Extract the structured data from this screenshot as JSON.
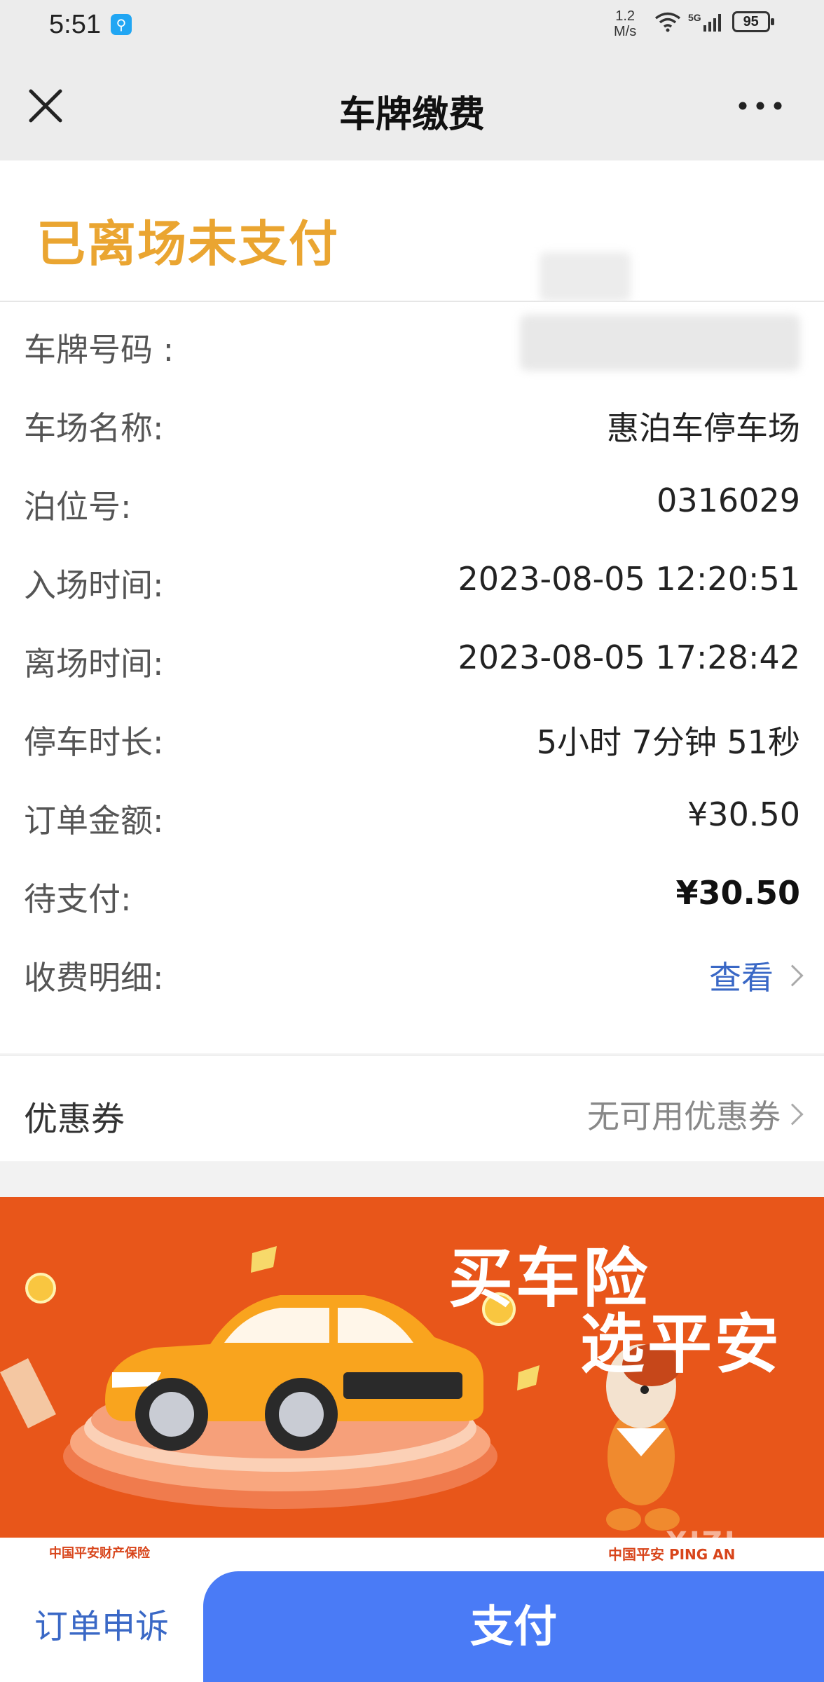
{
  "status_bar": {
    "time": "5:51",
    "speed_value": "1.2",
    "speed_unit": "M/s",
    "network": "5G",
    "battery": "95"
  },
  "nav": {
    "title": "车牌缴费",
    "close_icon": "close-icon",
    "more_icon": "more-icon"
  },
  "status": {
    "title": "已离场未支付",
    "color": "#eaa531"
  },
  "info": {
    "rows": [
      {
        "label": "车牌号码 :",
        "value": ""
      },
      {
        "label": "车场名称:",
        "value": "惠泊车停车场"
      },
      {
        "label": "泊位号:",
        "value": "0316029"
      },
      {
        "label": "入场时间:",
        "value": "2023-08-05 12:20:51"
      },
      {
        "label": "离场时间:",
        "value": "2023-08-05 17:28:42"
      },
      {
        "label": "停车时长:",
        "value": "5小时 7分钟 51秒"
      },
      {
        "label": "订单金额:",
        "value": "¥30.50"
      },
      {
        "label": "待支付:",
        "value": "¥30.50"
      },
      {
        "label": "收费明细:",
        "value": "查看"
      }
    ]
  },
  "coupon": {
    "label": "优惠券",
    "value": "无可用优惠券"
  },
  "banner": {
    "headline_1": "买车险",
    "headline_2": "选平安",
    "footer_left": "中国平安财产保险",
    "footer_right": "中国平安 PING AN",
    "watermark": "XIZI",
    "background_color": "#e8561a"
  },
  "bottom": {
    "appeal_label": "订单申诉",
    "pay_label": "支付",
    "accent_color": "#4a7bf6"
  }
}
